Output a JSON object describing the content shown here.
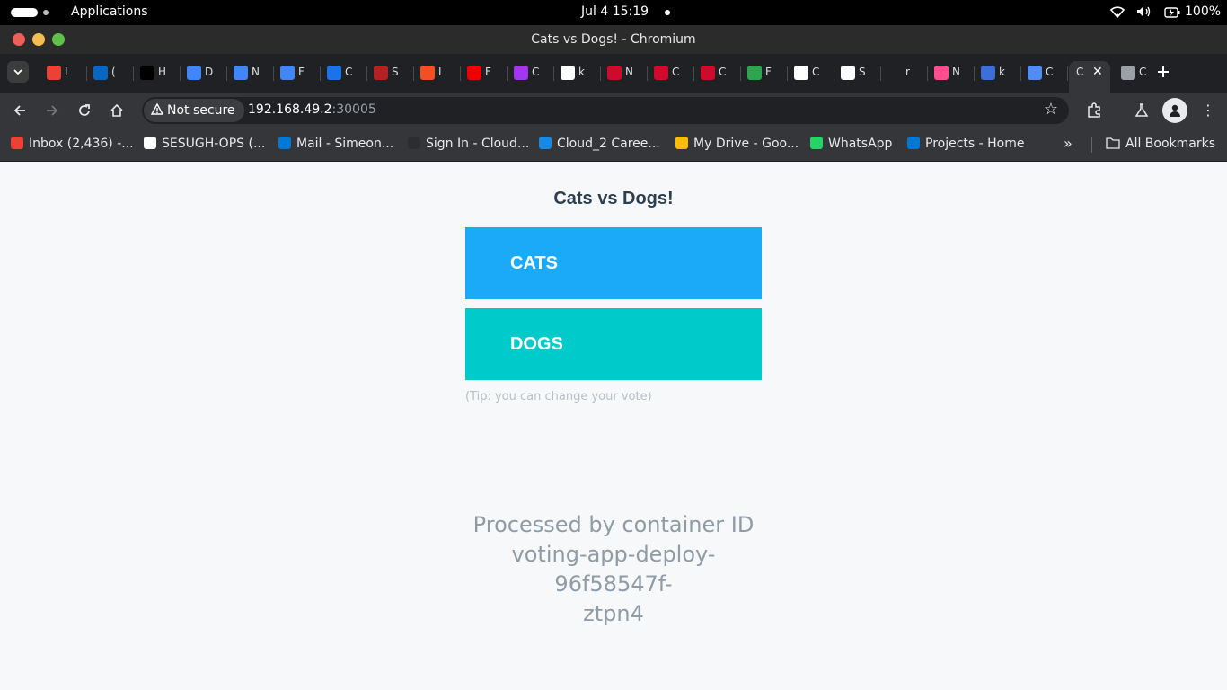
{
  "system_bar": {
    "apps_label": "Applications",
    "clock": "Jul 4  15:19",
    "battery": "100%"
  },
  "window": {
    "title": "Cats vs Dogs! - Chromium"
  },
  "tabs": [
    {
      "icon": "gmail-icon",
      "label": "I",
      "color": "#ea4335"
    },
    {
      "icon": "linkedin-icon",
      "label": "(",
      "color": "#0a66c2"
    },
    {
      "icon": "x-icon",
      "label": "H",
      "color": "#000000"
    },
    {
      "icon": "docs-icon",
      "label": "D",
      "color": "#4285f4"
    },
    {
      "icon": "docs-icon",
      "label": "N",
      "color": "#4285f4"
    },
    {
      "icon": "docs-icon",
      "label": "F",
      "color": "#4285f4"
    },
    {
      "icon": "link-icon",
      "label": "C",
      "color": "#1a73e8"
    },
    {
      "icon": "scribd-icon",
      "label": "S",
      "color": "#b22222"
    },
    {
      "icon": "microsoft-icon",
      "label": "I",
      "color": "#f25022"
    },
    {
      "icon": "redhat-icon",
      "label": "F",
      "color": "#ee0000"
    },
    {
      "icon": "udemy-icon",
      "label": "C",
      "color": "#a435f0"
    },
    {
      "icon": "github-icon",
      "label": "k",
      "color": "#ffffff"
    },
    {
      "icon": "huawei-icon",
      "label": "N",
      "color": "#cf0a2c"
    },
    {
      "icon": "huawei-icon",
      "label": "C",
      "color": "#cf0a2c"
    },
    {
      "icon": "huawei-icon",
      "label": "C",
      "color": "#cf0a2c"
    },
    {
      "icon": "fi-icon",
      "label": "F",
      "color": "#2ea44f"
    },
    {
      "icon": "openai-icon",
      "label": "C",
      "color": "#ffffff"
    },
    {
      "icon": "github-icon",
      "label": "S",
      "color": "#ffffff"
    },
    {
      "icon": "blank-icon",
      "label": "r",
      "color": "#202124"
    },
    {
      "icon": "cube-icon",
      "label": "N",
      "color": "#ff4d8d"
    },
    {
      "icon": "globe-icon",
      "label": "k",
      "color": "#3c6fd8"
    },
    {
      "icon": "gemini-icon",
      "label": "C",
      "color": "#4f8df5"
    },
    {
      "icon": "active-tab",
      "label": "C",
      "color": "#35363a"
    },
    {
      "icon": "globe-icon",
      "label": "C",
      "color": "#9aa0a6"
    }
  ],
  "toolbar": {
    "security_label": "Not secure",
    "url_host": "192.168.49.2",
    "url_port": ":30005"
  },
  "bookmarks": [
    {
      "icon": "gmail-icon",
      "label": "Inbox (2,436) -...",
      "color": "#ea4335"
    },
    {
      "icon": "github-icon",
      "label": "SESUGH-OPS (...",
      "color": "#ffffff"
    },
    {
      "icon": "outlook-icon",
      "label": "Mail - Simeon...",
      "color": "#0078d4"
    },
    {
      "icon": "cloud-icon",
      "label": "Sign In - Cloud...",
      "color": "#2d2d2d"
    },
    {
      "icon": "cloud-icon",
      "label": "Cloud_2 Caree...",
      "color": "#1a88e0"
    },
    {
      "icon": "drive-icon",
      "label": "My Drive - Goo...",
      "color": "#fbbc04"
    },
    {
      "icon": "whatsapp-icon",
      "label": "WhatsApp",
      "color": "#25d366"
    },
    {
      "icon": "azure-devops-icon",
      "label": "Projects - Home",
      "color": "#0078d4"
    }
  ],
  "bookmarks_all": "All Bookmarks",
  "app": {
    "title": "Cats vs Dogs!",
    "option_a": "CATS",
    "option_b": "DOGS",
    "tip": "(Tip: you can change your vote)",
    "processed_line1": "Processed by container ID",
    "processed_line2": "voting-app-deploy-96f58547f-",
    "processed_line3": "ztpn4",
    "colors": {
      "cats": "#1aaaf8",
      "dogs": "#00cbca",
      "title": "#2d3e50"
    }
  }
}
